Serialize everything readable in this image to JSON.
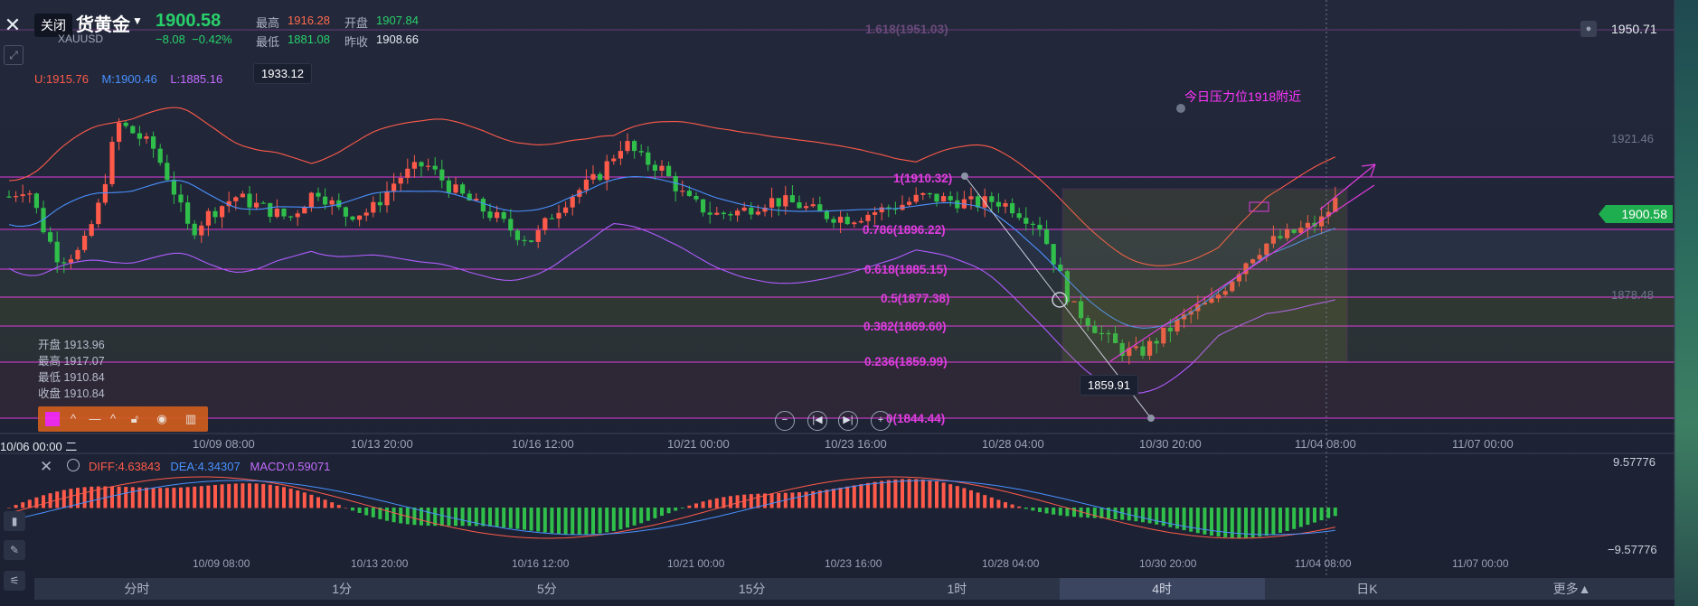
{
  "header": {
    "close_tooltip": "关闭",
    "symbol_name": "货黄金",
    "symbol_code": "XAUUSD",
    "last_price": "1900.58",
    "change": "−8.08",
    "change_pct": "−0.42%",
    "quote": {
      "high_label": "最高",
      "high": "1916.28",
      "open_label": "开盘",
      "open": "1907.84",
      "low_label": "最低",
      "low": "1881.08",
      "prev_close_label": "昨收",
      "prev_close": "1908.66"
    },
    "top_right_price": "1950.71"
  },
  "bollinger": {
    "upper": "U:1915.76",
    "middle": "M:1900.46",
    "lower": "L:1885.16",
    "colors": {
      "upper": "#ff5a4a",
      "middle": "#4a90ff",
      "lower": "#b05cff"
    }
  },
  "right_axis": {
    "top": "1921.46",
    "mid": "1878.48",
    "current_tag": "1900.58"
  },
  "fib_levels": [
    {
      "label": "1.618(1951.03)"
    },
    {
      "label": "1(1910.32)"
    },
    {
      "label": "0.786(1896.22)"
    },
    {
      "label": "0.618(1885.15)"
    },
    {
      "label": "0.5(1877.38)"
    },
    {
      "label": "0.382(1869.60)"
    },
    {
      "label": "0.236(1859.99)"
    },
    {
      "label": "0(1844.44)"
    }
  ],
  "callouts": {
    "high": "1933.12",
    "low": "1859.91"
  },
  "annotation_text": "今日压力位1918附近",
  "ohlc_panel": {
    "open": "开盘 1913.96",
    "high": "最高 1917.07",
    "low": "最低 1910.84",
    "close": "收盘 1910.84"
  },
  "x_axis": {
    "cursor_label": "10/06 00:00 二",
    "ticks": [
      "10/09 08:00",
      "10/13 20:00",
      "10/16 12:00",
      "10/21 00:00",
      "10/23 16:00",
      "10/28 04:00",
      "10/30 20:00",
      "11/04 08:00",
      "11/07 00:00"
    ]
  },
  "macd": {
    "diff": "DIFF:4.63843",
    "dea": "DEA:4.34307",
    "macd": "MACD:0.59071",
    "axis_top": "9.57776",
    "axis_bottom": "−9.57776",
    "colors": {
      "diff": "#ff5a4a",
      "dea": "#4a90ff",
      "up": "#ff5a4a",
      "down": "#2fbf4a"
    }
  },
  "tabs": [
    "分时",
    "1分",
    "5分",
    "15分",
    "1时",
    "4时",
    "日K",
    "更多▲"
  ],
  "active_tab": "4时",
  "icons": {
    "close": "close-icon",
    "draw": "draw-tool-icon",
    "bell": "bell-icon",
    "lock": "lock-icon",
    "eye": "eye-icon",
    "trash": "trash-icon"
  },
  "colors": {
    "up": "#ff5a4a",
    "down": "#2fbf4a",
    "fib": "#e03ce0",
    "accent_green": "#1fae4f"
  }
}
